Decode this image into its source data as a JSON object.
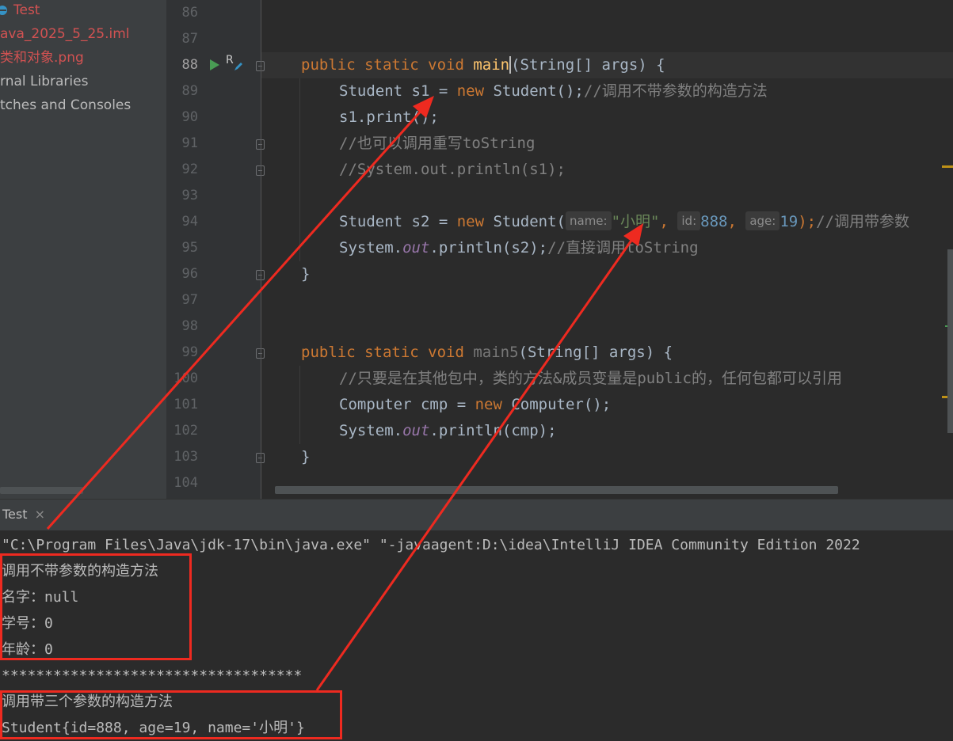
{
  "project_tree": {
    "items": [
      {
        "label": "Test",
        "color": "#d25252"
      },
      {
        "label": "ava_2025_5_25.iml",
        "color": "#d25252"
      },
      {
        "label": "类和对象.png",
        "color": "#d25252"
      },
      {
        "label": "rnal Libraries",
        "color": "#bbbbbb"
      },
      {
        "label": "tches and Consoles",
        "color": "#bbbbbb"
      }
    ]
  },
  "editor": {
    "line_numbers": [
      "86",
      "87",
      "88",
      "89",
      "90",
      "91",
      "92",
      "93",
      "94",
      "95",
      "96",
      "97",
      "98",
      "99",
      "100",
      "101",
      "102",
      "103",
      "104"
    ],
    "run_marker": "R",
    "lines": {
      "l88": {
        "kw1": "public static void ",
        "fn": "main",
        "rest": "(String[] args) {"
      },
      "l89": {
        "a": "Student s1 = ",
        "kw": "new",
        "b": " Student();",
        "cm": "//调用不带参数的构造方法"
      },
      "l90": {
        "a": "s1.print();"
      },
      "l91": {
        "cm": "//也可以调用重写toString"
      },
      "l92": {
        "cm": "//System.out.println(s1);"
      },
      "l94": {
        "a": "Student s2 = ",
        "kw": "new",
        "b": " Student(",
        "hint_name": "name:",
        "str": "\"小明\"",
        "c1": ", ",
        "hint_id": "id:",
        "num_id": "888",
        "c2": ", ",
        "hint_age": "age:",
        "num_age": "19",
        "d": ");",
        "cm": "//调用带参数"
      },
      "l95": {
        "a": "System.",
        "out": "out",
        "b": ".println(s2);",
        "cm": "//直接调用toString"
      },
      "l96": {
        "a": "}"
      },
      "l99": {
        "kw1": "public static void ",
        "fn": "main5",
        "rest": "(String[] args) {"
      },
      "l100": {
        "cm": "//只要是在其他包中，类的方法&成员变量是public的，任何包都可以引用"
      },
      "l101": {
        "a": "Computer cmp = ",
        "kw": "new",
        "b": " Computer();"
      },
      "l102": {
        "a": "System.",
        "out": "out",
        "b": ".println(cmp);"
      },
      "l103": {
        "a": "}"
      }
    }
  },
  "run_panel": {
    "tab_label": "Test",
    "close_glyph": "×",
    "console_lines": [
      "\"C:\\Program Files\\Java\\jdk-17\\bin\\java.exe\" \"-javaagent:D:\\idea\\IntelliJ IDEA Community Edition 2022",
      "调用不带参数的构造方法",
      "名字：null",
      "学号：0",
      "年龄：0",
      "***********************************",
      "调用带三个参数的构造方法",
      "Student{id=888, age=19, name='小明'}"
    ]
  },
  "colors": {
    "annotation_red": "#ee2a20",
    "run_green": "#499c54",
    "keyword": "#cc7832",
    "function": "#ffc66d"
  },
  "icons": [
    "run-gutter-icon",
    "edit-pencil-icon",
    "fold-marker-icon",
    "close-icon",
    "file-icon"
  ]
}
